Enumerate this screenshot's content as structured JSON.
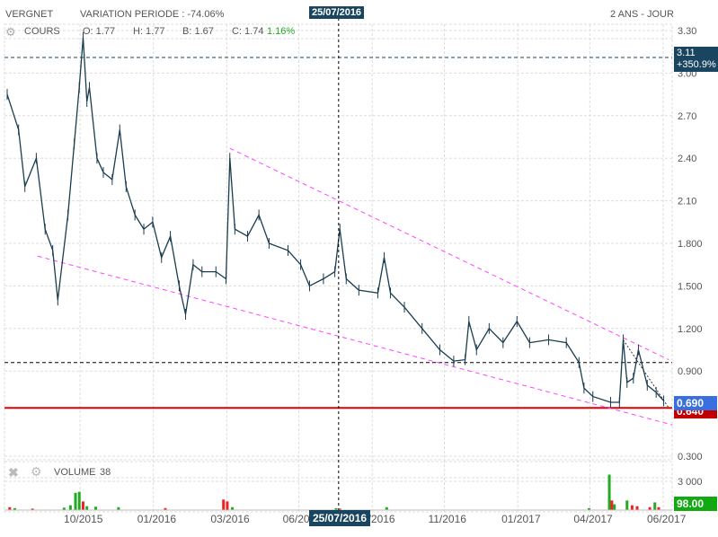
{
  "header": {
    "symbol": "VERGNET",
    "variation": "VARIATION PERIODE : -74.06%",
    "period": "2 ANS - JOUR",
    "crosshair_date": "25/07/2016"
  },
  "legend": {
    "cours": "COURS",
    "open": "O: 1.77",
    "high": "H: 1.77",
    "low": "B: 1.67",
    "close": "C: 1.74",
    "change": "1.16%",
    "volume": "VOLUME",
    "volume_value": "38"
  },
  "tags": {
    "high_price": "3.11",
    "high_pct": "+350.9%",
    "last_price": "0.690",
    "support": "0.640",
    "volume_last": "98.00"
  },
  "colors": {
    "price": "#1a3d4f",
    "trend": "#ff44ff",
    "support": "#e00000",
    "up": "#22aa22",
    "down": "#ee2222",
    "tag_dark": "#1a4560",
    "tag_blue": "#3a6fe0"
  },
  "chart_data": {
    "type": "line",
    "title": "VERGNET",
    "xlabel": "",
    "ylabel": "",
    "x_domain": [
      0,
      520
    ],
    "ylim": [
      0.3,
      3.3
    ],
    "grid": true,
    "y_ticks": [
      "3.30",
      "3.00",
      "2.70",
      "2.40",
      "2.10",
      "1.800",
      "1.500",
      "1.200",
      "0.900",
      "0.300"
    ],
    "y_tick_values": [
      3.3,
      3.0,
      2.7,
      2.4,
      2.1,
      1.8,
      1.5,
      1.2,
      0.9,
      0.3
    ],
    "x_ticks": [
      "10/2015",
      "01/2016",
      "03/2016",
      "06/2016",
      "09/2016",
      "11/2016",
      "01/2017",
      "04/2017",
      "06/2017"
    ],
    "x_tick_days": [
      59,
      117,
      175,
      232,
      290,
      347,
      405,
      462,
      520
    ],
    "price": [
      [
        0,
        2.85
      ],
      [
        9,
        2.6
      ],
      [
        14,
        2.2
      ],
      [
        23,
        2.4
      ],
      [
        30,
        1.9
      ],
      [
        36,
        1.75
      ],
      [
        40,
        1.4
      ],
      [
        48,
        2.0
      ],
      [
        53,
        2.5
      ],
      [
        57,
        2.9
      ],
      [
        60,
        3.25
      ],
      [
        63,
        2.8
      ],
      [
        65,
        2.9
      ],
      [
        71,
        2.4
      ],
      [
        76,
        2.3
      ],
      [
        83,
        2.25
      ],
      [
        89,
        2.6
      ],
      [
        94,
        2.2
      ],
      [
        101,
        2.0
      ],
      [
        108,
        1.9
      ],
      [
        115,
        1.95
      ],
      [
        122,
        1.7
      ],
      [
        129,
        1.85
      ],
      [
        136,
        1.5
      ],
      [
        141,
        1.3
      ],
      [
        147,
        1.65
      ],
      [
        154,
        1.6
      ],
      [
        165,
        1.6
      ],
      [
        173,
        1.55
      ],
      [
        176,
        2.4
      ],
      [
        180,
        1.9
      ],
      [
        190,
        1.85
      ],
      [
        199,
        2.0
      ],
      [
        207,
        1.8
      ],
      [
        222,
        1.75
      ],
      [
        232,
        1.65
      ],
      [
        239,
        1.5
      ],
      [
        250,
        1.55
      ],
      [
        259,
        1.6
      ],
      [
        263,
        1.9
      ],
      [
        268,
        1.55
      ],
      [
        278,
        1.47
      ],
      [
        293,
        1.45
      ],
      [
        298,
        1.7
      ],
      [
        303,
        1.45
      ],
      [
        314,
        1.35
      ],
      [
        328,
        1.2
      ],
      [
        342,
        1.05
      ],
      [
        353,
        0.97
      ],
      [
        362,
        0.98
      ],
      [
        365,
        1.25
      ],
      [
        371,
        1.05
      ],
      [
        381,
        1.2
      ],
      [
        392,
        1.1
      ],
      [
        403,
        1.25
      ],
      [
        413,
        1.1
      ],
      [
        428,
        1.12
      ],
      [
        442,
        1.1
      ],
      [
        452,
        0.96
      ],
      [
        456,
        0.78
      ],
      [
        463,
        0.72
      ],
      [
        477,
        0.68
      ],
      [
        484,
        0.68
      ],
      [
        487,
        1.12
      ],
      [
        490,
        0.82
      ],
      [
        495,
        0.85
      ],
      [
        499,
        1.05
      ],
      [
        506,
        0.8
      ],
      [
        513,
        0.75
      ],
      [
        519,
        0.69
      ]
    ],
    "trendlines": [
      {
        "from": [
          176,
          2.47
        ],
        "to": [
          523,
          0.98
        ],
        "style": "magenta-dashed"
      },
      {
        "from": [
          24,
          1.71
        ],
        "to": [
          526,
          0.52
        ],
        "style": "magenta-dashed"
      },
      {
        "from": [
          487,
          1.12
        ],
        "to": [
          523,
          0.64
        ],
        "style": "black-dotted"
      }
    ],
    "hlines": [
      {
        "value": 3.11,
        "style": "dark-dashed"
      },
      {
        "value": 0.96,
        "style": "black-dashed"
      },
      {
        "value": 0.64,
        "style": "red-solid"
      }
    ],
    "crosshair_day": 262,
    "volume": {
      "y_tick": "3 000",
      "y_tick_value": 3000,
      "ymax": 4500,
      "bars": [
        [
          2,
          300,
          "down"
        ],
        [
          6,
          200,
          "up"
        ],
        [
          20,
          150,
          "down"
        ],
        [
          45,
          250,
          "up"
        ],
        [
          50,
          500,
          "up"
        ],
        [
          54,
          1800,
          "up"
        ],
        [
          57,
          1900,
          "up"
        ],
        [
          60,
          900,
          "down"
        ],
        [
          63,
          400,
          "up"
        ],
        [
          70,
          350,
          "up"
        ],
        [
          88,
          300,
          "up"
        ],
        [
          125,
          200,
          "down"
        ],
        [
          171,
          1100,
          "down"
        ],
        [
          174,
          900,
          "down"
        ],
        [
          178,
          300,
          "up"
        ],
        [
          260,
          200,
          "up"
        ],
        [
          263,
          150,
          "down"
        ],
        [
          300,
          300,
          "up"
        ],
        [
          460,
          200,
          "up"
        ],
        [
          476,
          3700,
          "up"
        ],
        [
          478,
          1000,
          "down"
        ],
        [
          480,
          600,
          "up"
        ],
        [
          490,
          1000,
          "up"
        ],
        [
          494,
          500,
          "down"
        ],
        [
          498,
          400,
          "down"
        ],
        [
          508,
          300,
          "down"
        ],
        [
          512,
          800,
          "up"
        ],
        [
          515,
          300,
          "down"
        ]
      ]
    }
  }
}
